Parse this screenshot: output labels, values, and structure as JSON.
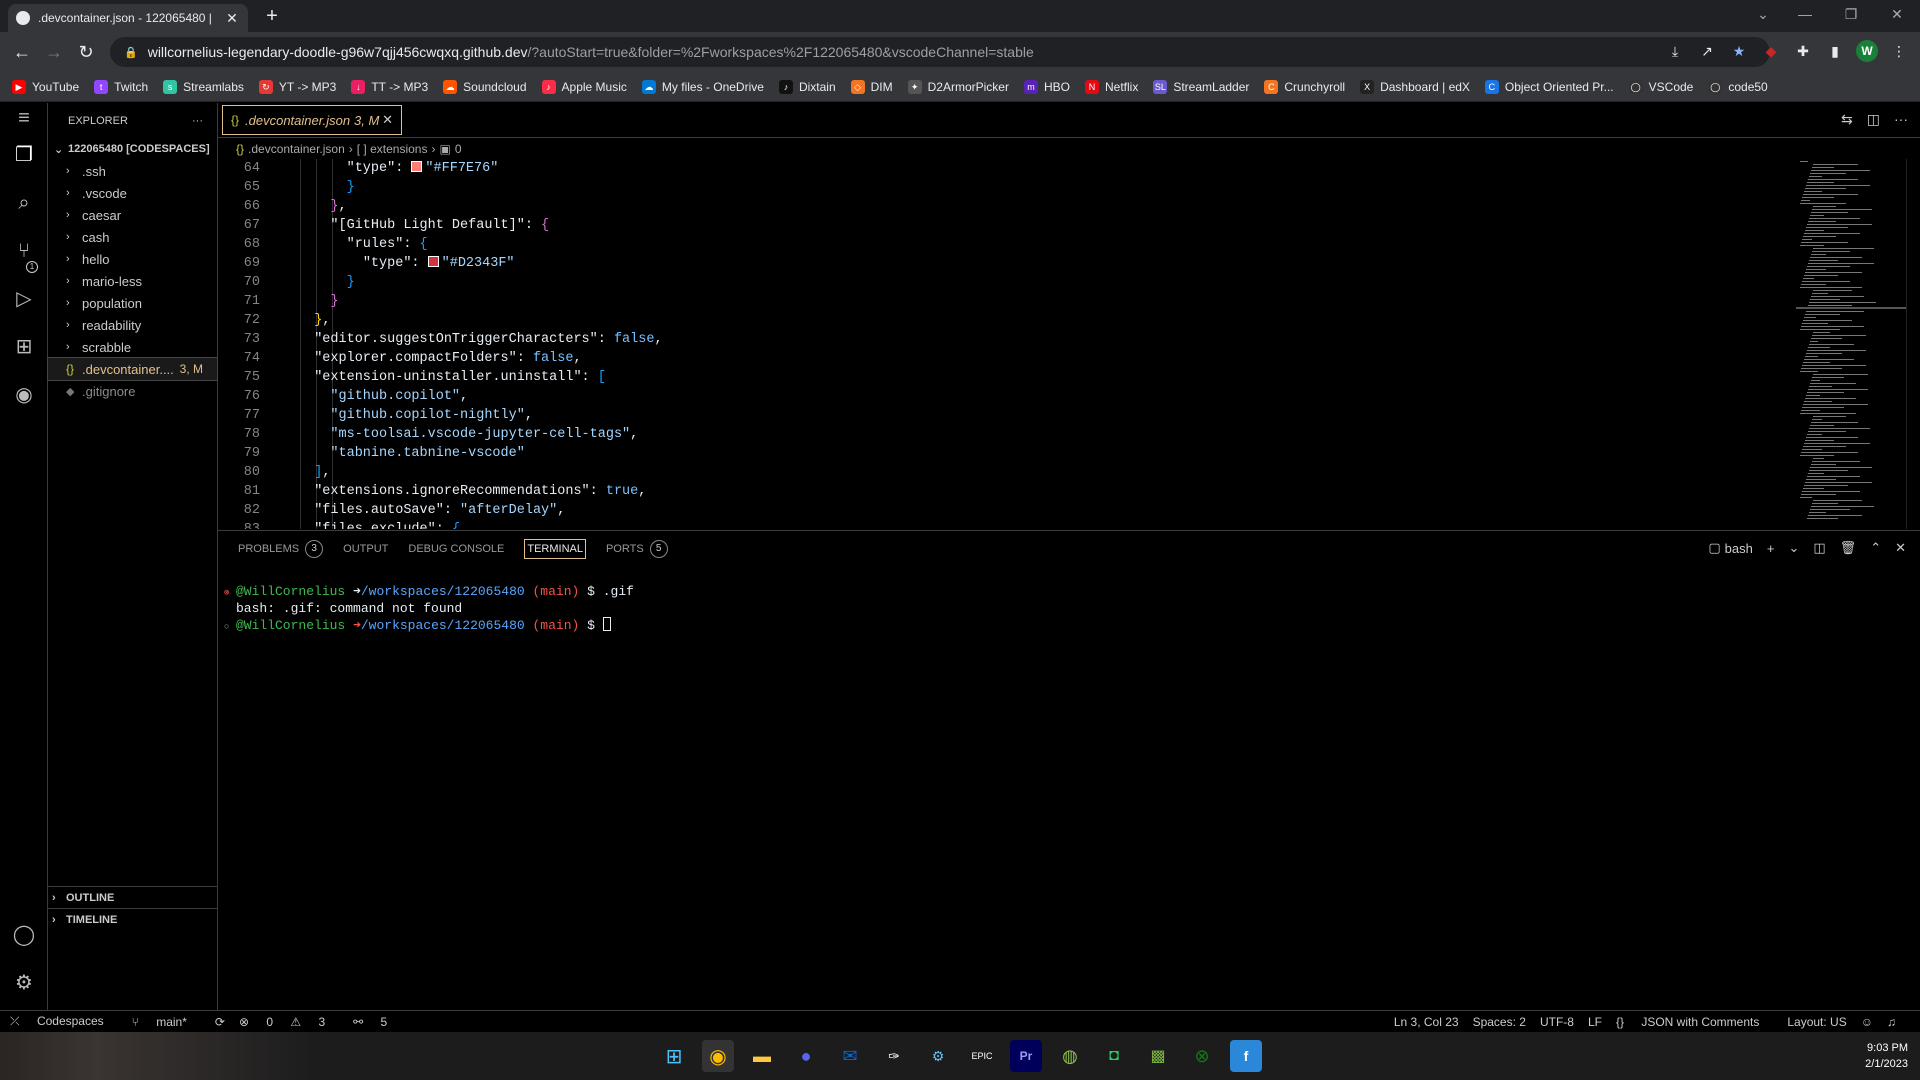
{
  "browser": {
    "tab_title": ".devcontainer.json - 122065480 |",
    "tab_close": "✕",
    "new_tab": "+",
    "url_host": "willcornelius-legendary-doodle-g96w7qjj456cwqxq.github.dev",
    "url_path": "/?autoStart=true&folder=%2Fworkspaces%2F122065480&vscodeChannel=stable",
    "profile_initial": "W"
  },
  "bookmarks": [
    {
      "label": "YouTube",
      "color": "#ff0000",
      "glyph": "▶"
    },
    {
      "label": "Twitch",
      "color": "#9146ff",
      "glyph": "t"
    },
    {
      "label": "Streamlabs",
      "color": "#31c3a2",
      "glyph": "s"
    },
    {
      "label": "YT -> MP3",
      "color": "#e53935",
      "glyph": "↻"
    },
    {
      "label": "TT -> MP3",
      "color": "#e91e63",
      "glyph": "↓"
    },
    {
      "label": "Soundcloud",
      "color": "#ff5500",
      "glyph": "☁"
    },
    {
      "label": "Apple Music",
      "color": "#fa2d48",
      "glyph": "♪"
    },
    {
      "label": "My files - OneDrive",
      "color": "#0078d4",
      "glyph": "☁"
    },
    {
      "label": "Dixtain",
      "color": "#111111",
      "glyph": "♪"
    },
    {
      "label": "DIM",
      "color": "#f37423",
      "glyph": "◇"
    },
    {
      "label": "D2ArmorPicker",
      "color": "#555555",
      "glyph": "✦"
    },
    {
      "label": "HBO",
      "color": "#5822b4",
      "glyph": "m"
    },
    {
      "label": "Netflix",
      "color": "#e50914",
      "glyph": "N"
    },
    {
      "label": "StreamLadder",
      "color": "#6a5acd",
      "glyph": "SL"
    },
    {
      "label": "Crunchyroll",
      "color": "#f47521",
      "glyph": "C"
    },
    {
      "label": "Dashboard | edX",
      "color": "#222222",
      "glyph": "X"
    },
    {
      "label": "Object Oriented Pr...",
      "color": "#1a73e8",
      "glyph": "C"
    },
    {
      "label": "VSCode",
      "color": "#333333",
      "glyph": "◯"
    },
    {
      "label": "code50",
      "color": "#333333",
      "glyph": "◯"
    }
  ],
  "explorer": {
    "title": "EXPLORER",
    "more": "···",
    "root": "122065480 [CODESPACES]",
    "folders": [
      ".ssh",
      ".vscode",
      "caesar",
      "cash",
      "hello",
      "mario-less",
      "population",
      "readability",
      "scrabble"
    ],
    "selected_file": ".devcontainer....",
    "selected_badge": "3, M",
    "ignored_file": ".gitignore",
    "outline": "OUTLINE",
    "timeline": "TIMELINE"
  },
  "editor": {
    "tab_label": ".devcontainer.json",
    "tab_badge": "3, M",
    "breadcrumb_file": ".devcontainer.json",
    "breadcrumb_node": "[ ] extensions",
    "breadcrumb_index": "0"
  },
  "code_lines": [
    {
      "n": "64",
      "html": "<span class='k'>      \"type\"</span>: <span class='sw' style='background:#FF7E76'></span><span class='str'>\"#FF7E76\"</span>"
    },
    {
      "n": "65",
      "html": "      <span class='p3'>}</span>"
    },
    {
      "n": "66",
      "html": "    <span class='p2'>}</span>,"
    },
    {
      "n": "67",
      "html": "    <span class='k'>\"[GitHub Light Default]\"</span>: <span class='p2'>{</span>"
    },
    {
      "n": "68",
      "html": "      <span class='k'>\"rules\"</span>: <span class='p3'>{</span>"
    },
    {
      "n": "69",
      "html": "        <span class='k'>\"type\"</span>: <span class='sw' style='background:#D2343F'></span><span class='str'>\"#D2343F\"</span>"
    },
    {
      "n": "70",
      "html": "      <span class='p3'>}</span>"
    },
    {
      "n": "71",
      "html": "    <span class='p2'>}</span>"
    },
    {
      "n": "72",
      "html": "  <span class='p1'>}</span>,"
    },
    {
      "n": "73",
      "html": "  <span class='k'>\"editor.suggestOnTriggerCharacters\"</span>: <span class='kw'>false</span>,"
    },
    {
      "n": "74",
      "html": "  <span class='k'>\"explorer.compactFolders\"</span>: <span class='kw'>false</span>,"
    },
    {
      "n": "75",
      "html": "  <span class='k'>\"extension-uninstaller.uninstall\"</span>: <span class='p3'>[</span>"
    },
    {
      "n": "76",
      "html": "    <span class='str'>\"github.copilot\"</span>,"
    },
    {
      "n": "77",
      "html": "    <span class='str'>\"github.copilot-nightly\"</span>,"
    },
    {
      "n": "78",
      "html": "    <span class='str'>\"ms-toolsai.vscode-jupyter-cell-tags\"</span>,"
    },
    {
      "n": "79",
      "html": "    <span class='str'>\"tabnine.tabnine-vscode\"</span>"
    },
    {
      "n": "80",
      "html": "  <span class='p3'>]</span>,"
    },
    {
      "n": "81",
      "html": "  <span class='k'>\"extensions.ignoreRecommendations\"</span>: <span class='kw'>true</span>,"
    },
    {
      "n": "82",
      "html": "  <span class='k'>\"files.autoSave\"</span>: <span class='str'>\"afterDelay\"</span>,"
    },
    {
      "n": "83",
      "html": "  <span class='k'>\"files.exclude\"</span>: <span class='p3'>{</span>"
    }
  ],
  "panel": {
    "tabs": [
      {
        "label": "PROBLEMS",
        "count": "3"
      },
      {
        "label": "OUTPUT",
        "count": ""
      },
      {
        "label": "DEBUG CONSOLE",
        "count": ""
      },
      {
        "label": "TERMINAL",
        "count": ""
      },
      {
        "label": "PORTS",
        "count": "5"
      }
    ],
    "shell": "bash"
  },
  "terminal": {
    "user": "@WillCornelius",
    "cwd": "/workspaces/122065480",
    "branch": "(main)",
    "cmd1": "$ .gif",
    "err": "bash: .gif: command not found",
    "prompt2": "$"
  },
  "status": {
    "remote": "Codespaces",
    "branch": "main*",
    "errors": "0",
    "warnings": "3",
    "ports": "5",
    "position": "Ln 3, Col 23",
    "spaces": "Spaces: 2",
    "encoding": "UTF-8",
    "eol": "LF",
    "language": "JSON with Comments",
    "layout": "Layout: US"
  },
  "clock": {
    "time": "9:03 PM",
    "date": "2/1/2023"
  },
  "colors": {
    "accent": "#e2c08d",
    "modified": "#e2c08d"
  }
}
